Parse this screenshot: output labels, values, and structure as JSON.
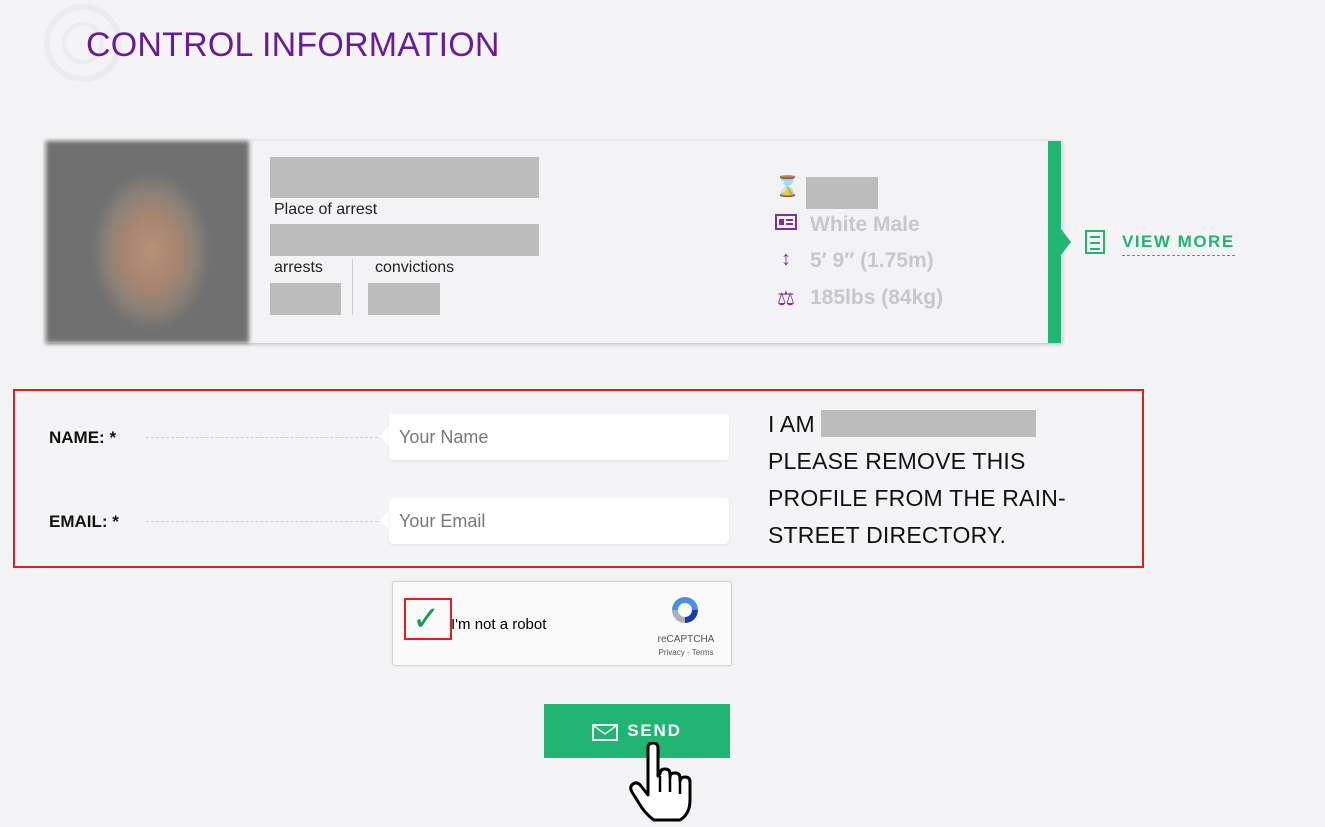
{
  "header": {
    "title": "CONTROL INFORMATION"
  },
  "profile": {
    "place_label": "Place of arrest",
    "arrests_label": "arrests",
    "convictions_label": "convictions",
    "stats": {
      "race_sex": "White Male",
      "height": "5′ 9″ (1.75m)",
      "weight": "185lbs (84kg)"
    },
    "view_more": "VIEW MORE"
  },
  "form": {
    "name_label": "NAME: *",
    "name_placeholder": "Your Name",
    "email_label": "EMAIL: *",
    "email_placeholder": "Your Email",
    "message_prefix": "I AM",
    "message_line2": "PLEASE REMOVE THIS",
    "message_line3": "PROFILE FROM THE RAIN-",
    "message_line4": "STREET DIRECTORY."
  },
  "captcha": {
    "label": "I'm not a robot",
    "brand": "reCAPTCHA",
    "links": "Privacy - Terms",
    "checked": true
  },
  "submit": {
    "label": "SEND"
  },
  "colors": {
    "accent": "#21b573",
    "title": "#6a1b9a",
    "highlight": "#e02020",
    "icon": "#7b2fa8"
  }
}
